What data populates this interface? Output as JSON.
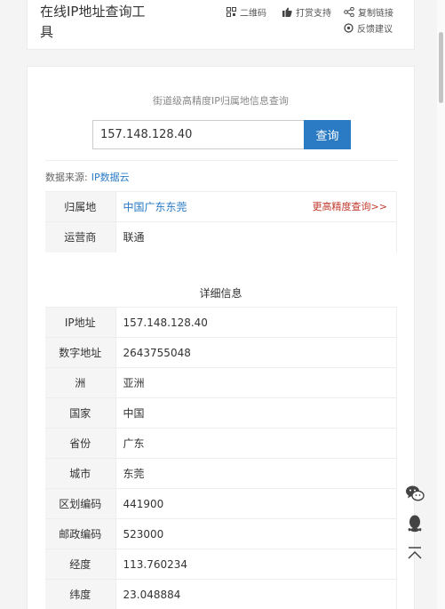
{
  "header": {
    "title": "在线IP地址查询工具",
    "tools": {
      "qrcode": "二维码",
      "support": "打赏支持",
      "copy_link": "复制链接",
      "feedback": "反馈建议"
    }
  },
  "search": {
    "subtitle": "街道级高精度IP归属地信息查询",
    "value": "157.148.128.40",
    "button": "查询"
  },
  "source": {
    "label": "数据来源:",
    "link": "IP数据云"
  },
  "summary": {
    "rows": [
      {
        "key": "归属地",
        "value": "中国广东东莞",
        "extra": "更高精度查询>>"
      },
      {
        "key": "运营商",
        "value": "联通"
      }
    ]
  },
  "detail": {
    "title": "详细信息",
    "rows": [
      {
        "key": "IP地址",
        "value": "157.148.128.40"
      },
      {
        "key": "数字地址",
        "value": "2643755048"
      },
      {
        "key": "洲",
        "value": "亚洲"
      },
      {
        "key": "国家",
        "value": "中国"
      },
      {
        "key": "省份",
        "value": "广东"
      },
      {
        "key": "城市",
        "value": "东莞"
      },
      {
        "key": "区划编码",
        "value": "441900"
      },
      {
        "key": "邮政编码",
        "value": "523000"
      },
      {
        "key": "经度",
        "value": "113.760234"
      },
      {
        "key": "纬度",
        "value": "23.048884"
      }
    ]
  },
  "colors": {
    "accent": "#2a7bc4",
    "link_red": "#c0392b",
    "key_bg": "#f5f5f5"
  },
  "icons": [
    "qrcode-icon",
    "thumbs-up-icon",
    "share-icon",
    "feedback-icon",
    "wechat-icon",
    "qq-icon",
    "back-to-top-icon"
  ]
}
